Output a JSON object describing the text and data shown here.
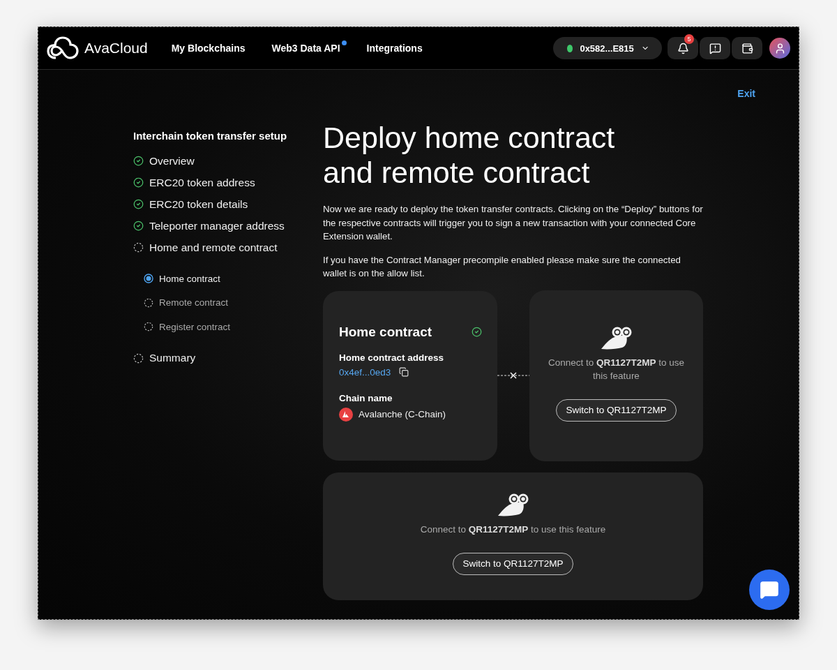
{
  "nav": {
    "logo": "AvaCloud",
    "links": [
      {
        "label": "My Blockchains",
        "dot": false
      },
      {
        "label": "Web3 Data API",
        "dot": true
      },
      {
        "label": "Integrations",
        "dot": false
      }
    ],
    "wallet": {
      "address": "0x582...E815",
      "connected": true
    },
    "notifications": "5"
  },
  "exit": "Exit",
  "sidebar": {
    "title": "Interchain token transfer setup",
    "steps": [
      {
        "label": "Overview",
        "done": true
      },
      {
        "label": "ERC20 token address",
        "done": true
      },
      {
        "label": "ERC20 token details",
        "done": true
      },
      {
        "label": "Teleporter manager address",
        "done": true
      },
      {
        "label": "Home and remote contract",
        "done": false,
        "children": [
          {
            "label": "Home contract",
            "selected": true
          },
          {
            "label": "Remote contract",
            "selected": false
          },
          {
            "label": "Register contract",
            "selected": false
          }
        ]
      },
      {
        "label": "Summary",
        "done": false
      }
    ]
  },
  "heading": "Deploy home contract and remote contract",
  "paragraphs": [
    "Now we are ready to deploy the token transfer contracts. Clicking on the “Deploy” buttons for the respective contracts will trigger you to sign a new transaction with your connected Core Extension wallet.",
    "If you have the Contract Manager precompile enabled please make sure the connected wallet is on the allow list."
  ],
  "home_card": {
    "title": "Home contract",
    "deployed": true,
    "address_label": "Home contract address",
    "address": "0x4ef...0ed3",
    "chain_label": "Chain name",
    "chain": "Avalanche (C-Chain)"
  },
  "remote_card": {
    "message": "Connect to **QR1127T2MP** to use this feature",
    "button": "Switch to QR1127T2MP"
  },
  "register_card": {
    "message": "Connect to **QR1127T2MP** to use this feature",
    "button": "Switch to QR1127T2MP"
  }
}
